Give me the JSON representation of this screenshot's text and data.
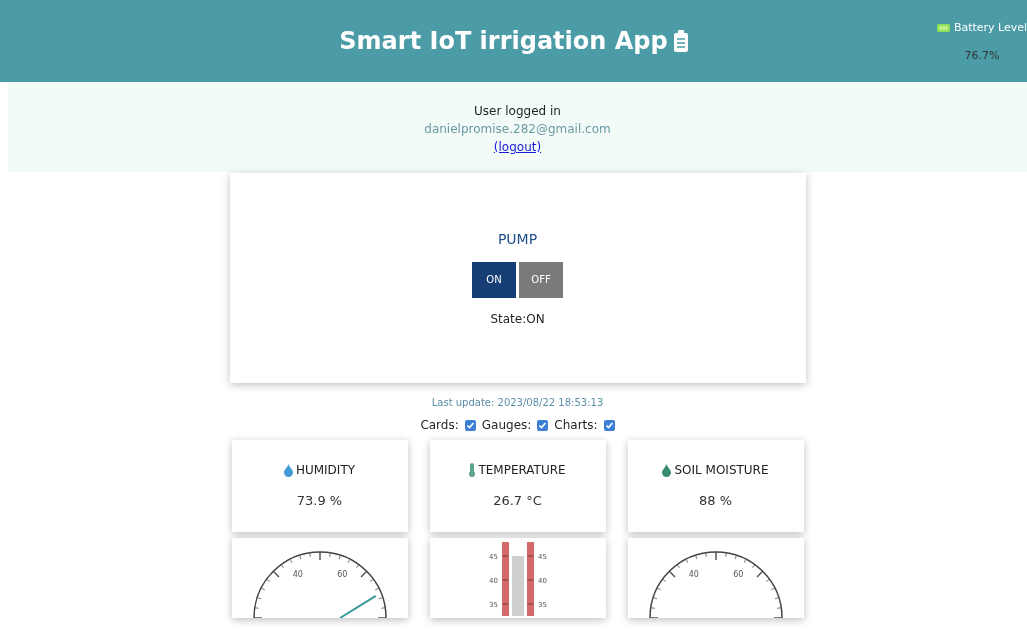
{
  "header": {
    "title": "Smart IoT irrigation App",
    "battery": {
      "label": "Battery Level",
      "value": "76.7%"
    }
  },
  "user": {
    "caption": "User logged in",
    "email": "danielpromise.282@gmail.com",
    "logout": "(logout)"
  },
  "pump": {
    "title": "PUMP",
    "buttons": [
      {
        "label": "ON",
        "selected": true
      },
      {
        "label": "OFF",
        "selected": false
      }
    ],
    "state": "State:ON"
  },
  "last_update": "Last update: 2023/08/22 18:53:13",
  "toggles": [
    {
      "label": "Cards:",
      "checked": true
    },
    {
      "label": "Gauges:",
      "checked": true
    },
    {
      "label": "Charts:",
      "checked": true
    }
  ],
  "cards": [
    {
      "kind": "humidity",
      "title": "HUMIDITY",
      "value": "73.9 %"
    },
    {
      "kind": "temperature",
      "title": "TEMPERATURE",
      "value": "26.7 °C"
    },
    {
      "kind": "soil",
      "title": "SOIL MOISTURE",
      "value": "88 %"
    }
  ],
  "gauges": [
    {
      "kind": "dial",
      "labels": [
        "40",
        "60"
      ],
      "needle": true
    },
    {
      "kind": "thermometer",
      "left_labels": [
        "45",
        "40",
        "35"
      ],
      "right_labels": [
        "45",
        "40",
        "35"
      ]
    },
    {
      "kind": "dial",
      "labels": [
        "40",
        "60"
      ],
      "needle": false
    }
  ]
}
